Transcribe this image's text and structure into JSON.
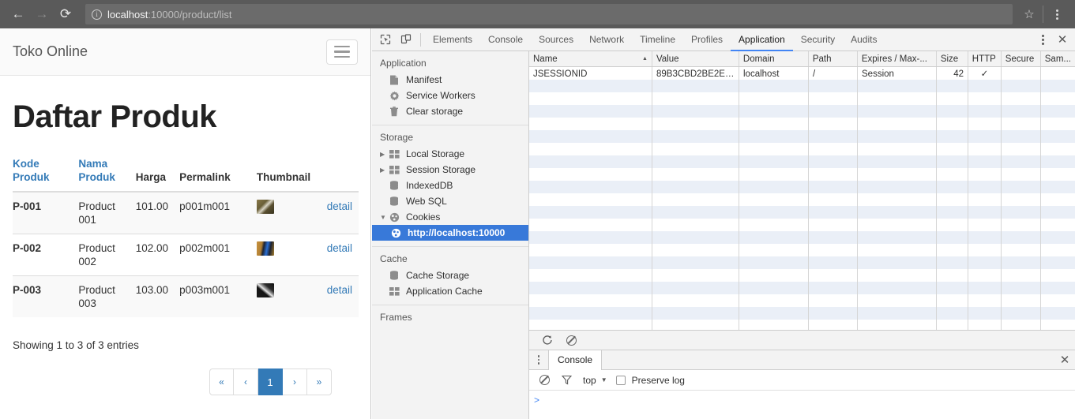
{
  "browser": {
    "back_icon": "arrow-left-icon",
    "forward_icon": "arrow-right-icon",
    "reload_icon": "reload-icon",
    "security_icon": "info-circle-icon",
    "url_host": "localhost",
    "url_rest": ":10000/product/list",
    "bookmark_icon": "star-icon",
    "menu_icon": "kebab-menu-icon"
  },
  "page": {
    "brand": "Toko Online",
    "menu_toggle_icon": "hamburger-icon",
    "title": "Daftar Produk",
    "table": {
      "headers": [
        "Kode Produk",
        "Nama Produk",
        "Harga",
        "Permalink",
        "Thumbnail",
        ""
      ],
      "sortable": [
        true,
        true,
        false,
        false,
        false,
        false
      ],
      "rows": [
        {
          "kode": "P-001",
          "nama": "Product 001",
          "harga": "101.00",
          "permalink": "p001m001",
          "thumb_colors": [
            "#8a7a4a",
            "#d8d4c4",
            "#3a3520"
          ],
          "action": "detail"
        },
        {
          "kode": "P-002",
          "nama": "Product 002",
          "harga": "102.00",
          "permalink": "p002m001",
          "thumb_colors": [
            "#c8923e",
            "#2a6fd4",
            "#1d2230"
          ],
          "action": "detail"
        },
        {
          "kode": "P-003",
          "nama": "Product 003",
          "harga": "103.00",
          "permalink": "p003m001",
          "thumb_colors": [
            "#1a1a1a",
            "#e8e8e8",
            "#2c2c2c"
          ],
          "action": "detail"
        }
      ]
    },
    "showing": "Showing 1 to 3 of 3 entries",
    "pagination": {
      "first": "«",
      "prev": "‹",
      "pages": [
        "1"
      ],
      "next": "›",
      "last": "»",
      "active_page": "1",
      "active_color": "#337ab7"
    },
    "link_color": "#337ab7"
  },
  "devtools": {
    "inspect_icon": "inspect-element-icon",
    "device_icon": "device-toolbar-icon",
    "tabs": [
      "Elements",
      "Console",
      "Sources",
      "Network",
      "Timeline",
      "Profiles",
      "Application",
      "Security",
      "Audits"
    ],
    "active_tab": "Application",
    "more_icon": "kebab-menu-icon",
    "close_icon": "close-icon",
    "accent_color": "#4285f4",
    "sidebar": {
      "sections": [
        {
          "title": "Application",
          "items": [
            {
              "label": "Manifest",
              "icon": "manifest-file-icon",
              "expandable": false,
              "selected": false
            },
            {
              "label": "Service Workers",
              "icon": "gear-icon",
              "expandable": false,
              "selected": false
            },
            {
              "label": "Clear storage",
              "icon": "trash-icon",
              "expandable": false,
              "selected": false
            }
          ]
        },
        {
          "title": "Storage",
          "items": [
            {
              "label": "Local Storage",
              "icon": "table-grid-icon",
              "expandable": true,
              "expanded": false,
              "selected": false
            },
            {
              "label": "Session Storage",
              "icon": "table-grid-icon",
              "expandable": true,
              "expanded": false,
              "selected": false
            },
            {
              "label": "IndexedDB",
              "icon": "database-icon",
              "expandable": false,
              "selected": false
            },
            {
              "label": "Web SQL",
              "icon": "database-icon",
              "expandable": false,
              "selected": false
            },
            {
              "label": "Cookies",
              "icon": "cookie-icon",
              "expandable": true,
              "expanded": true,
              "selected": false
            },
            {
              "label": "http://localhost:10000",
              "icon": "cookie-icon",
              "expandable": false,
              "selected": true,
              "indent": 1
            }
          ]
        },
        {
          "title": "Cache",
          "items": [
            {
              "label": "Cache Storage",
              "icon": "database-icon",
              "expandable": false,
              "selected": false
            },
            {
              "label": "Application Cache",
              "icon": "table-grid-icon",
              "expandable": false,
              "selected": false
            }
          ]
        }
      ],
      "frames_label": "Frames",
      "selected_color": "#3879d9"
    },
    "cookie_table": {
      "columns": [
        "Name",
        "Value",
        "Domain",
        "Path",
        "Expires / Max-...",
        "Size",
        "HTTP",
        "Secure",
        "Sam..."
      ],
      "sorted_column": "Name",
      "sort_direction": "asc",
      "rows": [
        {
          "name": "JSESSIONID",
          "value": "89B3CBD2BE2EB...",
          "domain": "localhost",
          "path": "/",
          "expires": "Session",
          "size": "42",
          "http": "✓",
          "secure": "",
          "samesite": ""
        }
      ],
      "empty_row_count": 20,
      "refresh_icon": "refresh-icon",
      "clear_icon": "clear-all-icon"
    },
    "drawer": {
      "menu_icon": "kebab-menu-icon",
      "tab": "Console",
      "close_icon": "close-icon",
      "clear_console_icon": "clear-console-icon",
      "filter_icon": "filter-funnel-icon",
      "context": "top",
      "context_caret_icon": "chevron-down-icon",
      "preserve_log_label": "Preserve log",
      "preserve_log_checked": false,
      "prompt": ">"
    }
  }
}
